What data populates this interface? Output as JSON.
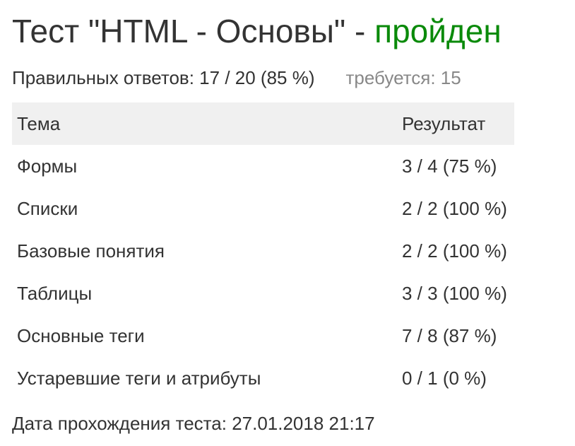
{
  "title": {
    "prefix": "Тест \"HTML - Основы\" - ",
    "status": "пройден"
  },
  "summary": {
    "correct": "Правильных ответов: 17 / 20 (85 %)",
    "required": "требуется: 15"
  },
  "table": {
    "headers": [
      "Тема",
      "Результат"
    ],
    "rows": [
      {
        "topic": "Формы",
        "result": "3 / 4 (75 %)"
      },
      {
        "topic": "Списки",
        "result": "2 / 2 (100 %)"
      },
      {
        "topic": "Базовые понятия",
        "result": "2 / 2 (100 %)"
      },
      {
        "topic": "Таблицы",
        "result": "3 / 3 (100 %)"
      },
      {
        "topic": "Основные теги",
        "result": "7 / 8 (87 %)"
      },
      {
        "topic": "Устаревшие теги и атрибуты",
        "result": "0 / 1 (0 %)"
      }
    ]
  },
  "footer": {
    "date": "Дата прохождения теста: 27.01.2018 21:17"
  },
  "colors": {
    "passed": "#0a8a0a",
    "muted": "#888888",
    "header_bg": "#f0f0f0"
  }
}
